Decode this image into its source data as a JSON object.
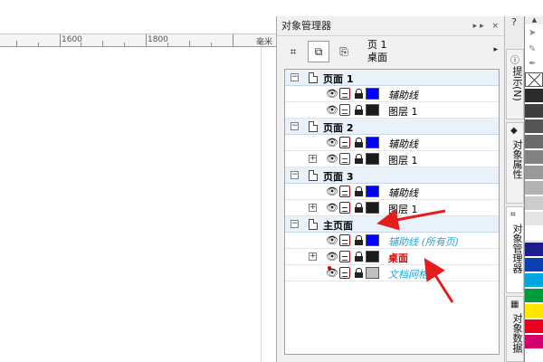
{
  "ruler": {
    "labels": [
      "1600",
      "1800"
    ],
    "unit": "毫米"
  },
  "docker": {
    "title": "对象管理器",
    "title_buttons": "▸▸ ×",
    "toolbar": {
      "current_page": "页 1",
      "current_layer": "桌面",
      "more_arrow": "▸"
    },
    "tree": {
      "page1": {
        "label": "页面 1",
        "layers": [
          {
            "label": "辅助线",
            "color": "#0000ff"
          },
          {
            "label": "图层 1",
            "color": "#1a1a1a"
          }
        ]
      },
      "page2": {
        "label": "页面 2",
        "layers": [
          {
            "label": "辅助线",
            "color": "#0000ff"
          },
          {
            "label": "图层 1",
            "color": "#1a1a1a"
          }
        ]
      },
      "page3": {
        "label": "页面 3",
        "layers": [
          {
            "label": "辅助线",
            "color": "#0000ff"
          },
          {
            "label": "图层 1",
            "color": "#1a1a1a"
          }
        ]
      },
      "master": {
        "label": "主页面",
        "layers": [
          {
            "label": "辅助线 (所有页)",
            "color": "#0000ff"
          },
          {
            "label": "桌面",
            "color": "#1a1a1a"
          },
          {
            "label": "文档网格",
            "color": "#c0c0c0"
          }
        ]
      }
    }
  },
  "side_tabs": {
    "help": "?",
    "tabs": [
      "提示(N)",
      "对象属性",
      "对象管理器",
      "对象数据"
    ]
  },
  "palette": {
    "colors": [
      "#2b2b2b",
      "#3f3f3f",
      "#555555",
      "#6b6b6b",
      "#828282",
      "#9a9a9a",
      "#b3b3b3",
      "#cccccc",
      "#e5e5e5",
      "#ffffff",
      "#1c1c8c",
      "#0a3fb2",
      "#00a6e0",
      "#009b3a",
      "#ffe600",
      "#e8001c",
      "#d1006d"
    ]
  },
  "colors": {
    "annotation_arrow": "#e41e1e",
    "page_row_bg": "#e9f1fb"
  }
}
